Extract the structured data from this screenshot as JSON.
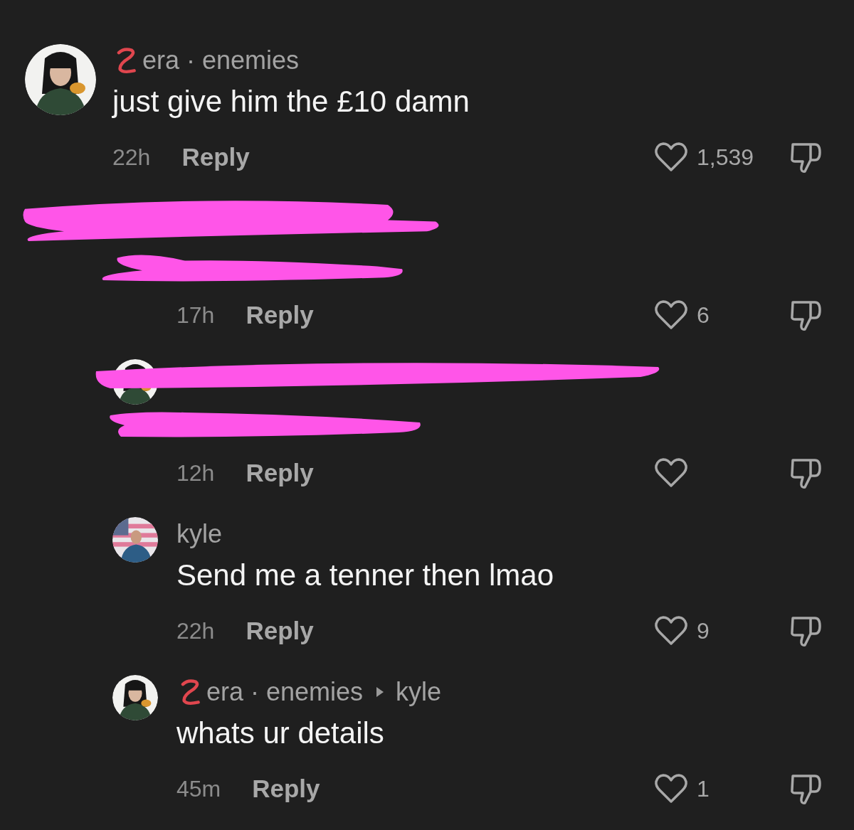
{
  "comments": [
    {
      "reply": false,
      "redacted": false,
      "badge": true,
      "name": "era · enemies",
      "text": "just give him the £10 damn",
      "time": "22h",
      "reply_label": "Reply",
      "likes": "1,539"
    },
    {
      "reply": true,
      "redacted": true,
      "avatar": false,
      "time": "17h",
      "reply_label": "Reply",
      "likes": "6"
    },
    {
      "reply": true,
      "redacted": true,
      "avatar": true,
      "time": "12h",
      "reply_label": "Reply"
    },
    {
      "reply": true,
      "redacted": false,
      "badge": false,
      "name": "kyle",
      "text": "Send me a tenner then lmao",
      "time": "22h",
      "reply_label": "Reply",
      "likes": "9"
    },
    {
      "reply": true,
      "redacted": false,
      "badge": true,
      "name": "era · enemies",
      "reply_to": "kyle",
      "text": "whats ur details",
      "time": "45m",
      "reply_label": "Reply",
      "likes": "1"
    }
  ]
}
